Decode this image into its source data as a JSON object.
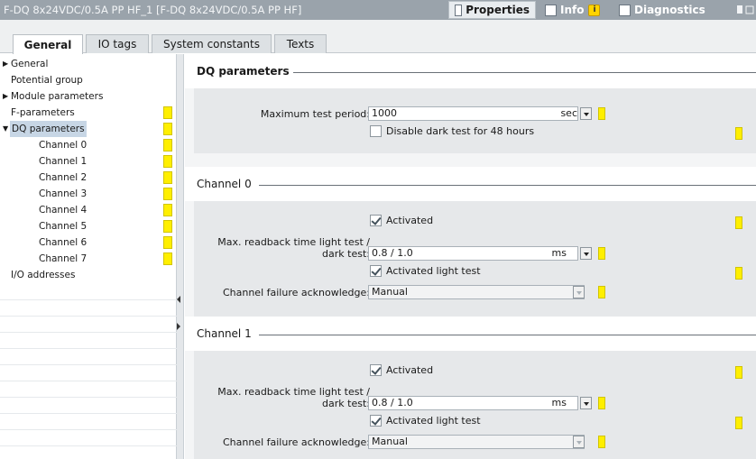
{
  "window": {
    "title": "F-DQ 8x24VDC/0.5A PP HF_1 [F-DQ 8x24VDC/0.5A PP HF]",
    "tabs": [
      "Properties",
      "Info",
      "Diagnostics"
    ]
  },
  "subtabs": [
    "General",
    "IO tags",
    "System constants",
    "Texts"
  ],
  "tree": {
    "items": [
      {
        "label": "General",
        "level": 0,
        "arrow": "right"
      },
      {
        "label": "Potential group",
        "level": 0
      },
      {
        "label": "Module parameters",
        "level": 0,
        "arrow": "right"
      },
      {
        "label": "F-parameters",
        "level": 0,
        "flag": true
      },
      {
        "label": "DQ parameters",
        "level": 0,
        "arrow": "down",
        "selected": true,
        "flag": true
      },
      {
        "label": "Channel 0",
        "level": 1,
        "flag": true
      },
      {
        "label": "Channel 1",
        "level": 1,
        "flag": true
      },
      {
        "label": "Channel 2",
        "level": 1,
        "flag": true
      },
      {
        "label": "Channel 3",
        "level": 1,
        "flag": true
      },
      {
        "label": "Channel 4",
        "level": 1,
        "flag": true
      },
      {
        "label": "Channel 5",
        "level": 1,
        "flag": true
      },
      {
        "label": "Channel 6",
        "level": 1,
        "flag": true
      },
      {
        "label": "Channel 7",
        "level": 1,
        "flag": true
      },
      {
        "label": "I/O addresses",
        "level": 0
      }
    ]
  },
  "dq_params": {
    "heading": "DQ parameters",
    "max_test_period_label": "Maximum test period:",
    "max_test_period_value": "1000",
    "max_test_period_unit": "sec",
    "disable_dark_test_label": "Disable dark test for 48 hours",
    "disable_dark_test_checked": false
  },
  "channels": [
    {
      "heading": "Channel 0",
      "activated_label": "Activated",
      "activated": true,
      "readback_label_1": "Max. readback time light test /",
      "readback_label_2": "dark test:",
      "readback_value": "0.8 / 1.0",
      "readback_unit": "ms",
      "light_test_label": "Activated light test",
      "light_test": true,
      "ack_label": "Channel failure acknowledge:",
      "ack_value": "Manual"
    },
    {
      "heading": "Channel 1",
      "activated_label": "Activated",
      "activated": true,
      "readback_label_1": "Max. readback time light test /",
      "readback_label_2": "dark test:",
      "readback_value": "0.8 / 1.0",
      "readback_unit": "ms",
      "light_test_label": "Activated light test",
      "light_test": true,
      "ack_label": "Channel failure acknowledge:",
      "ack_value": "Manual"
    }
  ],
  "colors": {
    "titlebar": "#9aa3ab",
    "selection": "#c7d6e5",
    "flag_yellow": "#ffef00"
  }
}
